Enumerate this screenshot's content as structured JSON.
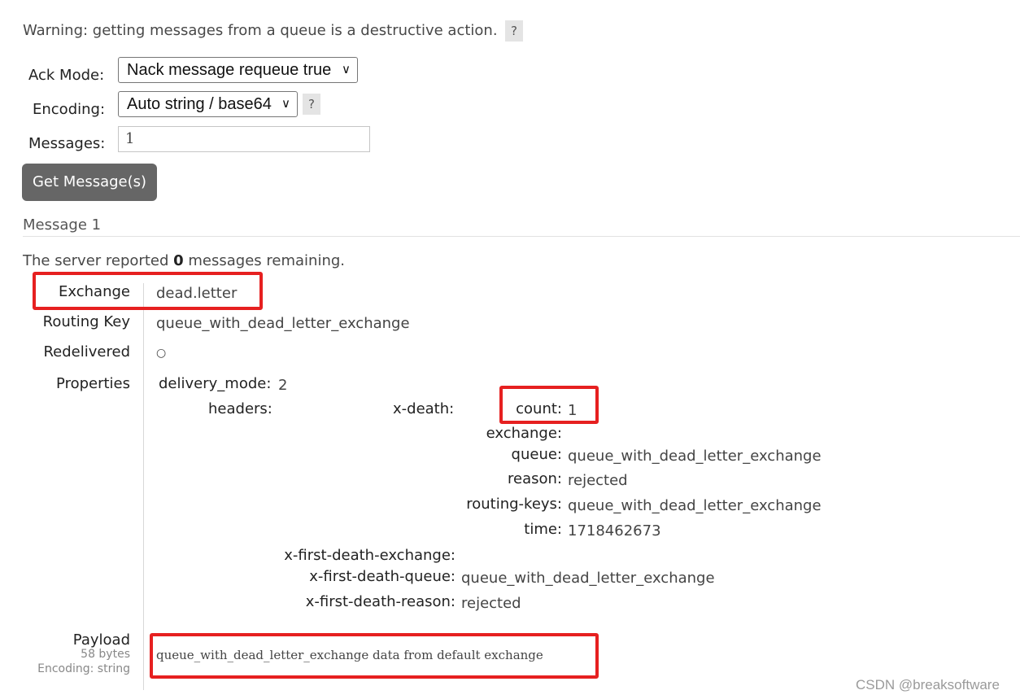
{
  "warning": {
    "text": "Warning: getting messages from a queue is a destructive action.",
    "help": "?"
  },
  "form": {
    "ack_mode_label": "Ack Mode:",
    "ack_mode_value": "Nack message requeue true",
    "encoding_label": "Encoding:",
    "encoding_value": "Auto string / base64",
    "encoding_help": "?",
    "messages_label": "Messages:",
    "messages_value": "1",
    "get_button": "Get Message(s)"
  },
  "message": {
    "section_title": "Message 1",
    "remaining_prefix": "The server reported",
    "remaining_count": "0",
    "remaining_suffix": "messages remaining.",
    "exchange_label": "Exchange",
    "exchange_value": "dead.letter",
    "routing_key_label": "Routing Key",
    "routing_key_value": "queue_with_dead_letter_exchange",
    "redelivered_label": "Redelivered",
    "redelivered_value": "○",
    "properties_label": "Properties",
    "properties": {
      "delivery_mode_key": "delivery_mode:",
      "delivery_mode_value": "2",
      "headers_key": "headers:",
      "x_death_key": "x-death:",
      "count_key": "count:",
      "count_value": "1",
      "exchange_key": "exchange:",
      "exchange_value": "",
      "queue_key": "queue:",
      "queue_value": "queue_with_dead_letter_exchange",
      "reason_key": "reason:",
      "reason_value": "rejected",
      "routing_keys_key": "routing-keys:",
      "routing_keys_value": "queue_with_dead_letter_exchange",
      "time_key": "time:",
      "time_value": "1718462673",
      "first_death_exchange_key": "x-first-death-exchange:",
      "first_death_exchange_value": "",
      "first_death_queue_key": "x-first-death-queue:",
      "first_death_queue_value": "queue_with_dead_letter_exchange",
      "first_death_reason_key": "x-first-death-reason:",
      "first_death_reason_value": "rejected"
    },
    "payload_label": "Payload",
    "payload_size": "58 bytes",
    "payload_encoding": "Encoding: string",
    "payload_value": "queue_with_dead_letter_exchange data from default exchange"
  },
  "watermark": "CSDN @breaksoftware",
  "colors": {
    "highlight": "#e62020",
    "button": "#666666"
  }
}
